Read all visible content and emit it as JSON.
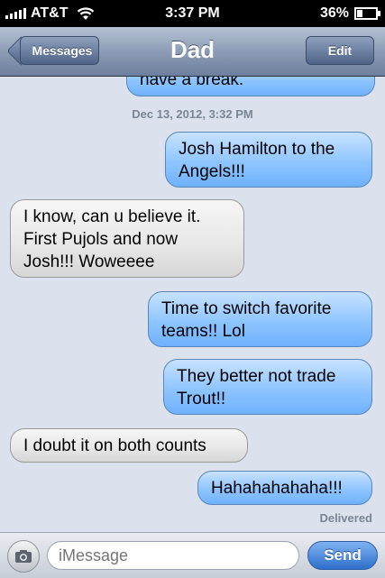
{
  "status_bar": {
    "carrier": "AT&T",
    "time": "3:37 PM",
    "battery": "36%",
    "battery_level": 0.36,
    "icons": [
      "signal-icon",
      "wifi-icon",
      "battery-icon"
    ]
  },
  "nav": {
    "back_label": "Messages",
    "title": "Dad",
    "edit_label": "Edit"
  },
  "conversation": {
    "partial_message": "have a break.",
    "timestamp": "Dec 13, 2012, 3:32 PM",
    "messages": [
      {
        "direction": "out",
        "text": "Josh Hamilton to the Angels!!!"
      },
      {
        "direction": "in",
        "text": "I know, can u believe it. First Pujols and now Josh!!! Woweeee"
      },
      {
        "direction": "out",
        "text": "Time to switch favorite teams!! Lol"
      },
      {
        "direction": "out",
        "text": "They better not trade Trout!!"
      },
      {
        "direction": "in",
        "text": "I doubt it on both counts"
      },
      {
        "direction": "out",
        "text": "Hahahahahaha!!!"
      }
    ],
    "delivered": "Delivered"
  },
  "input_bar": {
    "placeholder": "iMessage",
    "send_label": "Send"
  },
  "colors": {
    "outgoing_bubble": "#8ec5ff",
    "incoming_bubble": "#e7e7e7",
    "background": "#dbe2ed",
    "nav": "#8d9db6",
    "send": "#2f6fcc"
  }
}
